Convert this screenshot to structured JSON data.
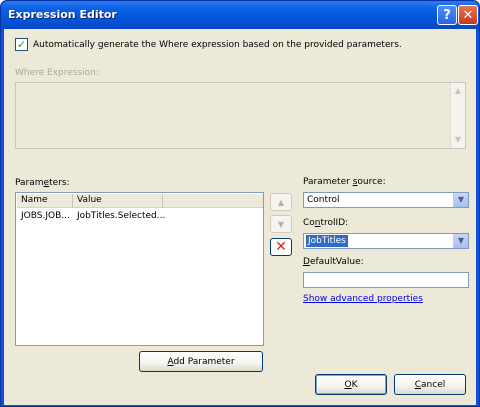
{
  "window": {
    "title": "Expression Editor",
    "help_glyph": "?",
    "close_glyph": "✕"
  },
  "auto_generate": {
    "checked": true,
    "check_glyph": "✓",
    "label_pre": "Automatically ",
    "label_mnemonic": "g",
    "label_post": "enerate the Where expression based on the provided parameters."
  },
  "where_expression": {
    "label": "Where Expression:",
    "value": "",
    "scroll_up_glyph": "▲",
    "scroll_down_glyph": "▼"
  },
  "parameters": {
    "label_pre": "Param",
    "label_mnemonic": "e",
    "label_post": "ters:",
    "columns": [
      "Name",
      "Value"
    ],
    "rows": [
      {
        "name": "JOBS.JOB...",
        "value": "JobTitles.Selected..."
      }
    ],
    "move_up_glyph": "▲",
    "move_down_glyph": "▼",
    "delete_glyph": "✕"
  },
  "parameter_source": {
    "label_pre": "Parameter ",
    "label_mnemonic": "s",
    "label_post": "ource:",
    "selected": "Control"
  },
  "control_id": {
    "label_pre": "Co",
    "label_mnemonic": "n",
    "label_post": "trolID:",
    "selected": "JobTitles"
  },
  "default_value": {
    "label_pre": "",
    "label_mnemonic": "D",
    "label_post": "efaultValue:",
    "value": ""
  },
  "advanced_link": "Show advanced properties",
  "dropdown_glyph": "▼",
  "buttons": {
    "add_parameter": {
      "pre": "",
      "mnemonic": "A",
      "post": "dd Parameter"
    },
    "ok": {
      "pre": "",
      "mnemonic": "O",
      "post": "K"
    },
    "cancel": {
      "pre": "",
      "mnemonic": "C",
      "post": "ancel"
    }
  },
  "colors": {
    "titlebar": "#0553d8",
    "dialog_face": "#ece9d8",
    "selection": "#316ac5",
    "link": "#0000ee",
    "delete_icon": "#d5241c"
  }
}
